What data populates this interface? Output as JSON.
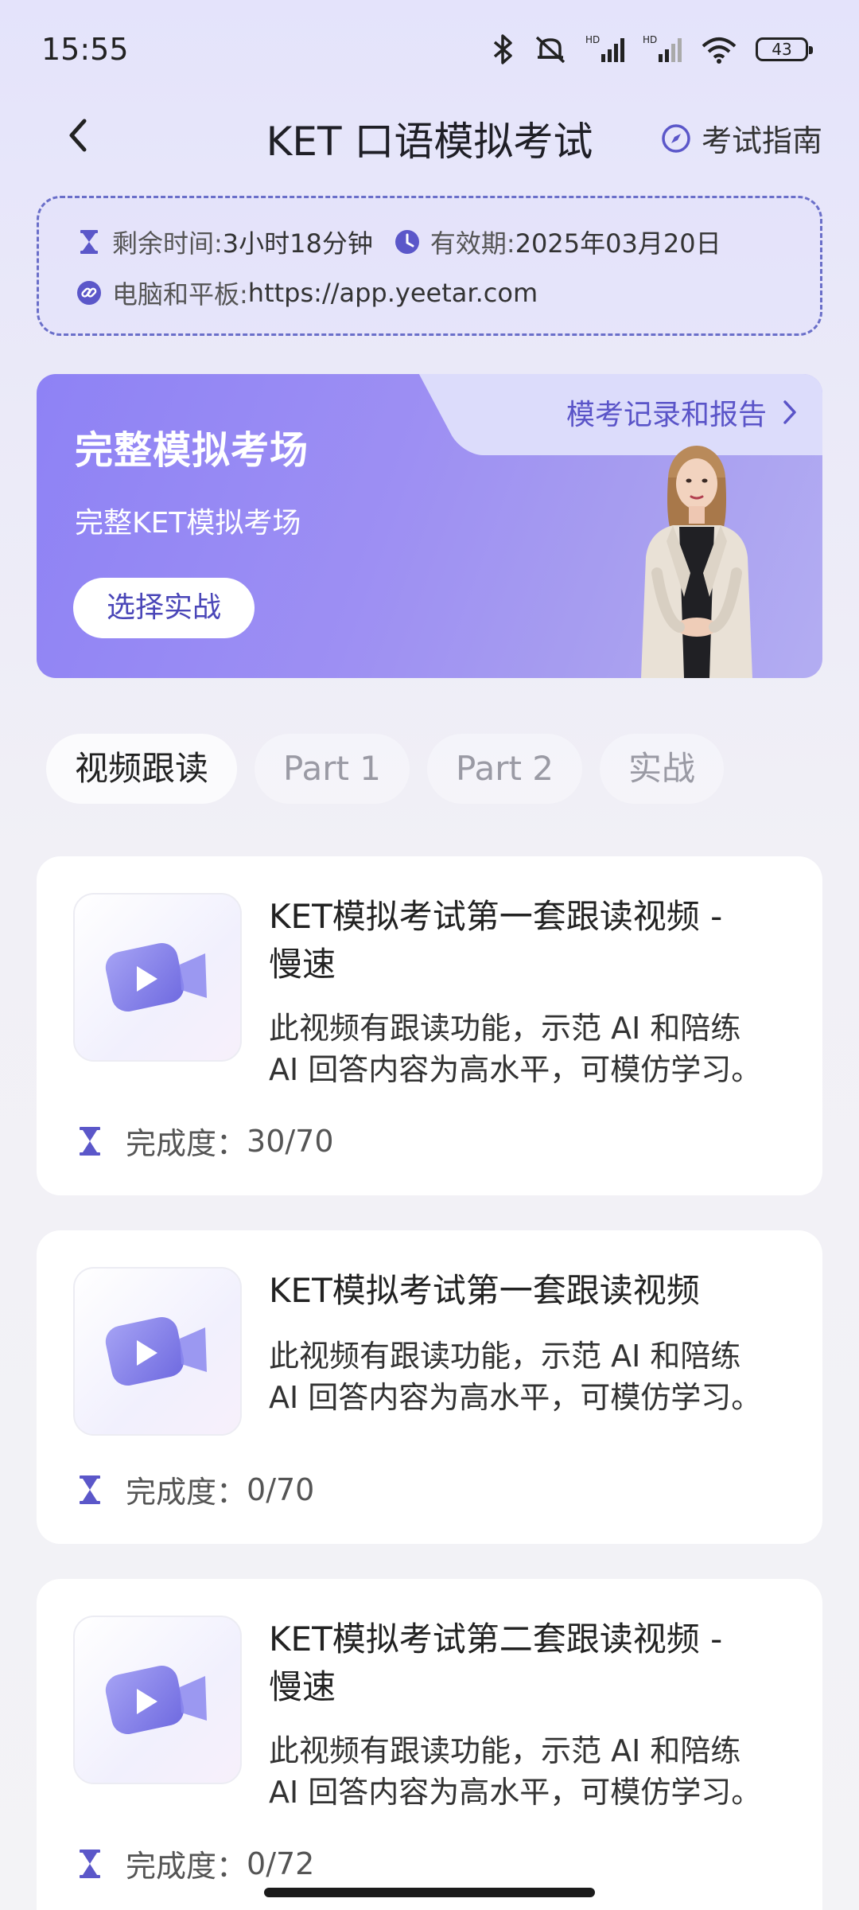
{
  "status_bar": {
    "time": "15:55",
    "battery": "43"
  },
  "header": {
    "title": "KET 口语模拟考试",
    "guide_label": "考试指南"
  },
  "info": {
    "remaining_label": "剩余时间:",
    "remaining_value": "3小时18分钟",
    "validity_label": "有效期:",
    "validity_value": "2025年03月20日",
    "link_label": "电脑和平板:",
    "link_value": "https://app.yeetar.com"
  },
  "banner": {
    "records_label": "模考记录和报告",
    "title": "完整模拟考场",
    "subtitle": "完整KET模拟考场",
    "button": "选择实战"
  },
  "tabs": [
    {
      "label": "视频跟读",
      "active": true
    },
    {
      "label": "Part 1",
      "active": false
    },
    {
      "label": "Part 2",
      "active": false
    },
    {
      "label": "实战",
      "active": false
    }
  ],
  "cards": [
    {
      "title_line1": "KET模拟考试第一套跟读视频 -",
      "title_line2": "慢速",
      "desc_line1": "此视频有跟读功能，示范 AI 和陪练",
      "desc_line2": "AI 回答内容为高水平，可模仿学习。",
      "progress_label": "完成度：",
      "progress_value": "30/70"
    },
    {
      "title_line1": "KET模拟考试第一套跟读视频",
      "title_line2": "",
      "desc_line1": "此视频有跟读功能，示范 AI 和陪练",
      "desc_line2": "AI 回答内容为高水平，可模仿学习。",
      "progress_label": "完成度：",
      "progress_value": "0/70"
    },
    {
      "title_line1": "KET模拟考试第二套跟读视频 -",
      "title_line2": "慢速",
      "desc_line1": "此视频有跟读功能，示范 AI 和陪练",
      "desc_line2": "AI 回答内容为高水平，可模仿学习。",
      "progress_label": "完成度：",
      "progress_value": "0/72"
    }
  ],
  "colors": {
    "accent": "#5a54c8",
    "banner_start": "#8e82f5",
    "icon": "#5b57c9"
  }
}
